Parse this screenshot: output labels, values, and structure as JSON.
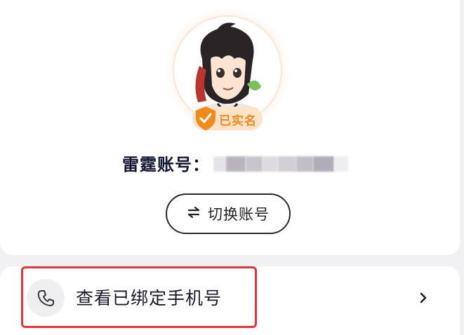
{
  "profile": {
    "verified_badge": "已实名",
    "account_label": "雷霆账号：",
    "account_value_masked": true
  },
  "actions": {
    "switch_account_label": "切换账号",
    "switch_icon": "swap-arrows-icon"
  },
  "phone_row": {
    "label": "查看已绑定手机号",
    "icon": "phone-icon",
    "chevron": "chevron-right-icon"
  },
  "colors": {
    "badge_orange": "#f28a1a",
    "badge_bg": "#fde3c8",
    "highlight_red": "#e0363c",
    "page_bg": "#f1f1f3"
  }
}
